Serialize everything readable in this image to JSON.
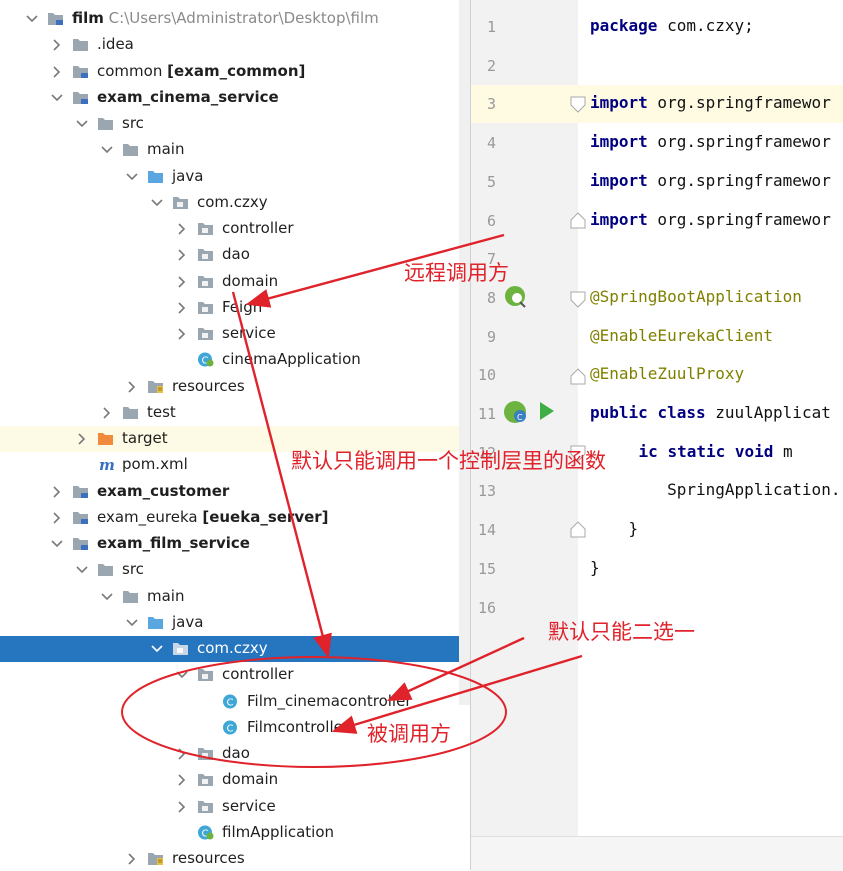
{
  "tree": {
    "rows": [
      {
        "label": "film",
        "bold": true,
        "path": "C:\\Users\\Administrator\\Desktop\\film",
        "chev": "down",
        "icon": "folder-module"
      },
      {
        "label": ".idea",
        "chev": "right",
        "icon": "folder"
      },
      {
        "label": "common",
        "module": "[exam_common]",
        "chev": "right",
        "icon": "folder-module"
      },
      {
        "label": "exam_cinema_service",
        "bold": true,
        "chev": "down",
        "icon": "folder-module"
      },
      {
        "label": "src",
        "chev": "down",
        "icon": "folder"
      },
      {
        "label": "main",
        "chev": "down",
        "icon": "folder"
      },
      {
        "label": "java",
        "chev": "down",
        "icon": "folder-source"
      },
      {
        "label": "com.czxy",
        "chev": "down",
        "icon": "package"
      },
      {
        "label": "controller",
        "chev": "right",
        "icon": "package"
      },
      {
        "label": "dao",
        "chev": "right",
        "icon": "package"
      },
      {
        "label": "domain",
        "chev": "right",
        "icon": "package"
      },
      {
        "label": "Feign",
        "chev": "right",
        "icon": "package"
      },
      {
        "label": "service",
        "chev": "right",
        "icon": "package"
      },
      {
        "label": "cinemaApplication",
        "chev": "none",
        "icon": "spring-class"
      },
      {
        "label": "resources",
        "chev": "right",
        "icon": "folder-resources"
      },
      {
        "label": "test",
        "chev": "right",
        "icon": "folder"
      },
      {
        "label": "target",
        "chev": "right",
        "icon": "folder-excluded",
        "highlight": "yellow"
      },
      {
        "label": "pom.xml",
        "chev": "none",
        "icon": "maven"
      },
      {
        "label": "exam_customer",
        "bold": true,
        "chev": "right",
        "icon": "folder-module"
      },
      {
        "label": "exam_eureka",
        "module": "[eueka_server]",
        "chev": "right",
        "icon": "folder-module"
      },
      {
        "label": "exam_film_service",
        "bold": true,
        "chev": "down",
        "icon": "folder-module"
      },
      {
        "label": "src",
        "chev": "down",
        "icon": "folder"
      },
      {
        "label": "main",
        "chev": "down",
        "icon": "folder"
      },
      {
        "label": "java",
        "chev": "down",
        "icon": "folder-source"
      },
      {
        "label": "com.czxy",
        "chev": "down",
        "icon": "package",
        "highlight": "selected"
      },
      {
        "label": "controller",
        "chev": "down",
        "icon": "package"
      },
      {
        "label": "Film_cinemacontroller",
        "chev": "none",
        "icon": "class"
      },
      {
        "label": "Filmcontroller",
        "chev": "none",
        "icon": "class"
      },
      {
        "label": "dao",
        "chev": "right",
        "icon": "package"
      },
      {
        "label": "domain",
        "chev": "right",
        "icon": "package"
      },
      {
        "label": "service",
        "chev": "right",
        "icon": "package"
      },
      {
        "label": "filmApplication",
        "chev": "none",
        "icon": "spring-class"
      },
      {
        "label": "resources",
        "chev": "right",
        "icon": "folder-resources"
      }
    ]
  },
  "editor": {
    "line_numbers": [
      "1",
      "2",
      "3",
      "4",
      "5",
      "6",
      "7",
      "8",
      "9",
      "10",
      "11",
      "12",
      "13",
      "14",
      "15",
      "16"
    ],
    "lines": [
      {
        "segments": [
          {
            "t": "package",
            "c": "kw"
          },
          {
            "t": " com.czxy;"
          }
        ]
      },
      {
        "segments": []
      },
      {
        "segments": [
          {
            "t": "import",
            "c": "kw"
          },
          {
            "t": " org.springframewor"
          }
        ]
      },
      {
        "segments": [
          {
            "t": "import",
            "c": "kw"
          },
          {
            "t": " org.springframewor"
          }
        ]
      },
      {
        "segments": [
          {
            "t": "import",
            "c": "kw"
          },
          {
            "t": " org.springframewor"
          }
        ]
      },
      {
        "segments": [
          {
            "t": "import",
            "c": "kw"
          },
          {
            "t": " org.springframewor"
          }
        ]
      },
      {
        "segments": []
      },
      {
        "segments": [
          {
            "t": "@SpringBootApplication",
            "c": "ann"
          }
        ]
      },
      {
        "segments": [
          {
            "t": "@EnableEurekaClient",
            "c": "ann"
          }
        ]
      },
      {
        "segments": [
          {
            "t": "@EnableZuulProxy",
            "c": "ann"
          }
        ]
      },
      {
        "segments": [
          {
            "t": "public",
            "c": "kw"
          },
          {
            "t": " "
          },
          {
            "t": "class",
            "c": "kw"
          },
          {
            "t": " zuulApplicat"
          }
        ]
      },
      {
        "segments": [
          {
            "t": "    "
          },
          {
            "t": "ic",
            "c": "kw"
          },
          {
            "t": " "
          },
          {
            "t": "static",
            "c": "kw"
          },
          {
            "t": " "
          },
          {
            "t": "void",
            "c": "kw"
          },
          {
            "t": " m"
          }
        ]
      },
      {
        "segments": [
          {
            "t": "        SpringApplication."
          }
        ]
      },
      {
        "segments": [
          {
            "t": "    }"
          }
        ]
      },
      {
        "segments": [
          {
            "t": "}"
          }
        ]
      },
      {
        "segments": []
      }
    ]
  },
  "annotations": {
    "remote_caller": "远程调用方",
    "default_one_controller": "默认只能调用一个控制层里的函数",
    "default_choose_one": "默认只能二选一",
    "callee": "被调用方",
    "color": "#e0232b"
  },
  "colors": {
    "selection": "#2675bf",
    "keyword": "#000080",
    "annotation": "#808000",
    "folder": "#9aa7b0",
    "source_folder": "#5aa6e0"
  }
}
